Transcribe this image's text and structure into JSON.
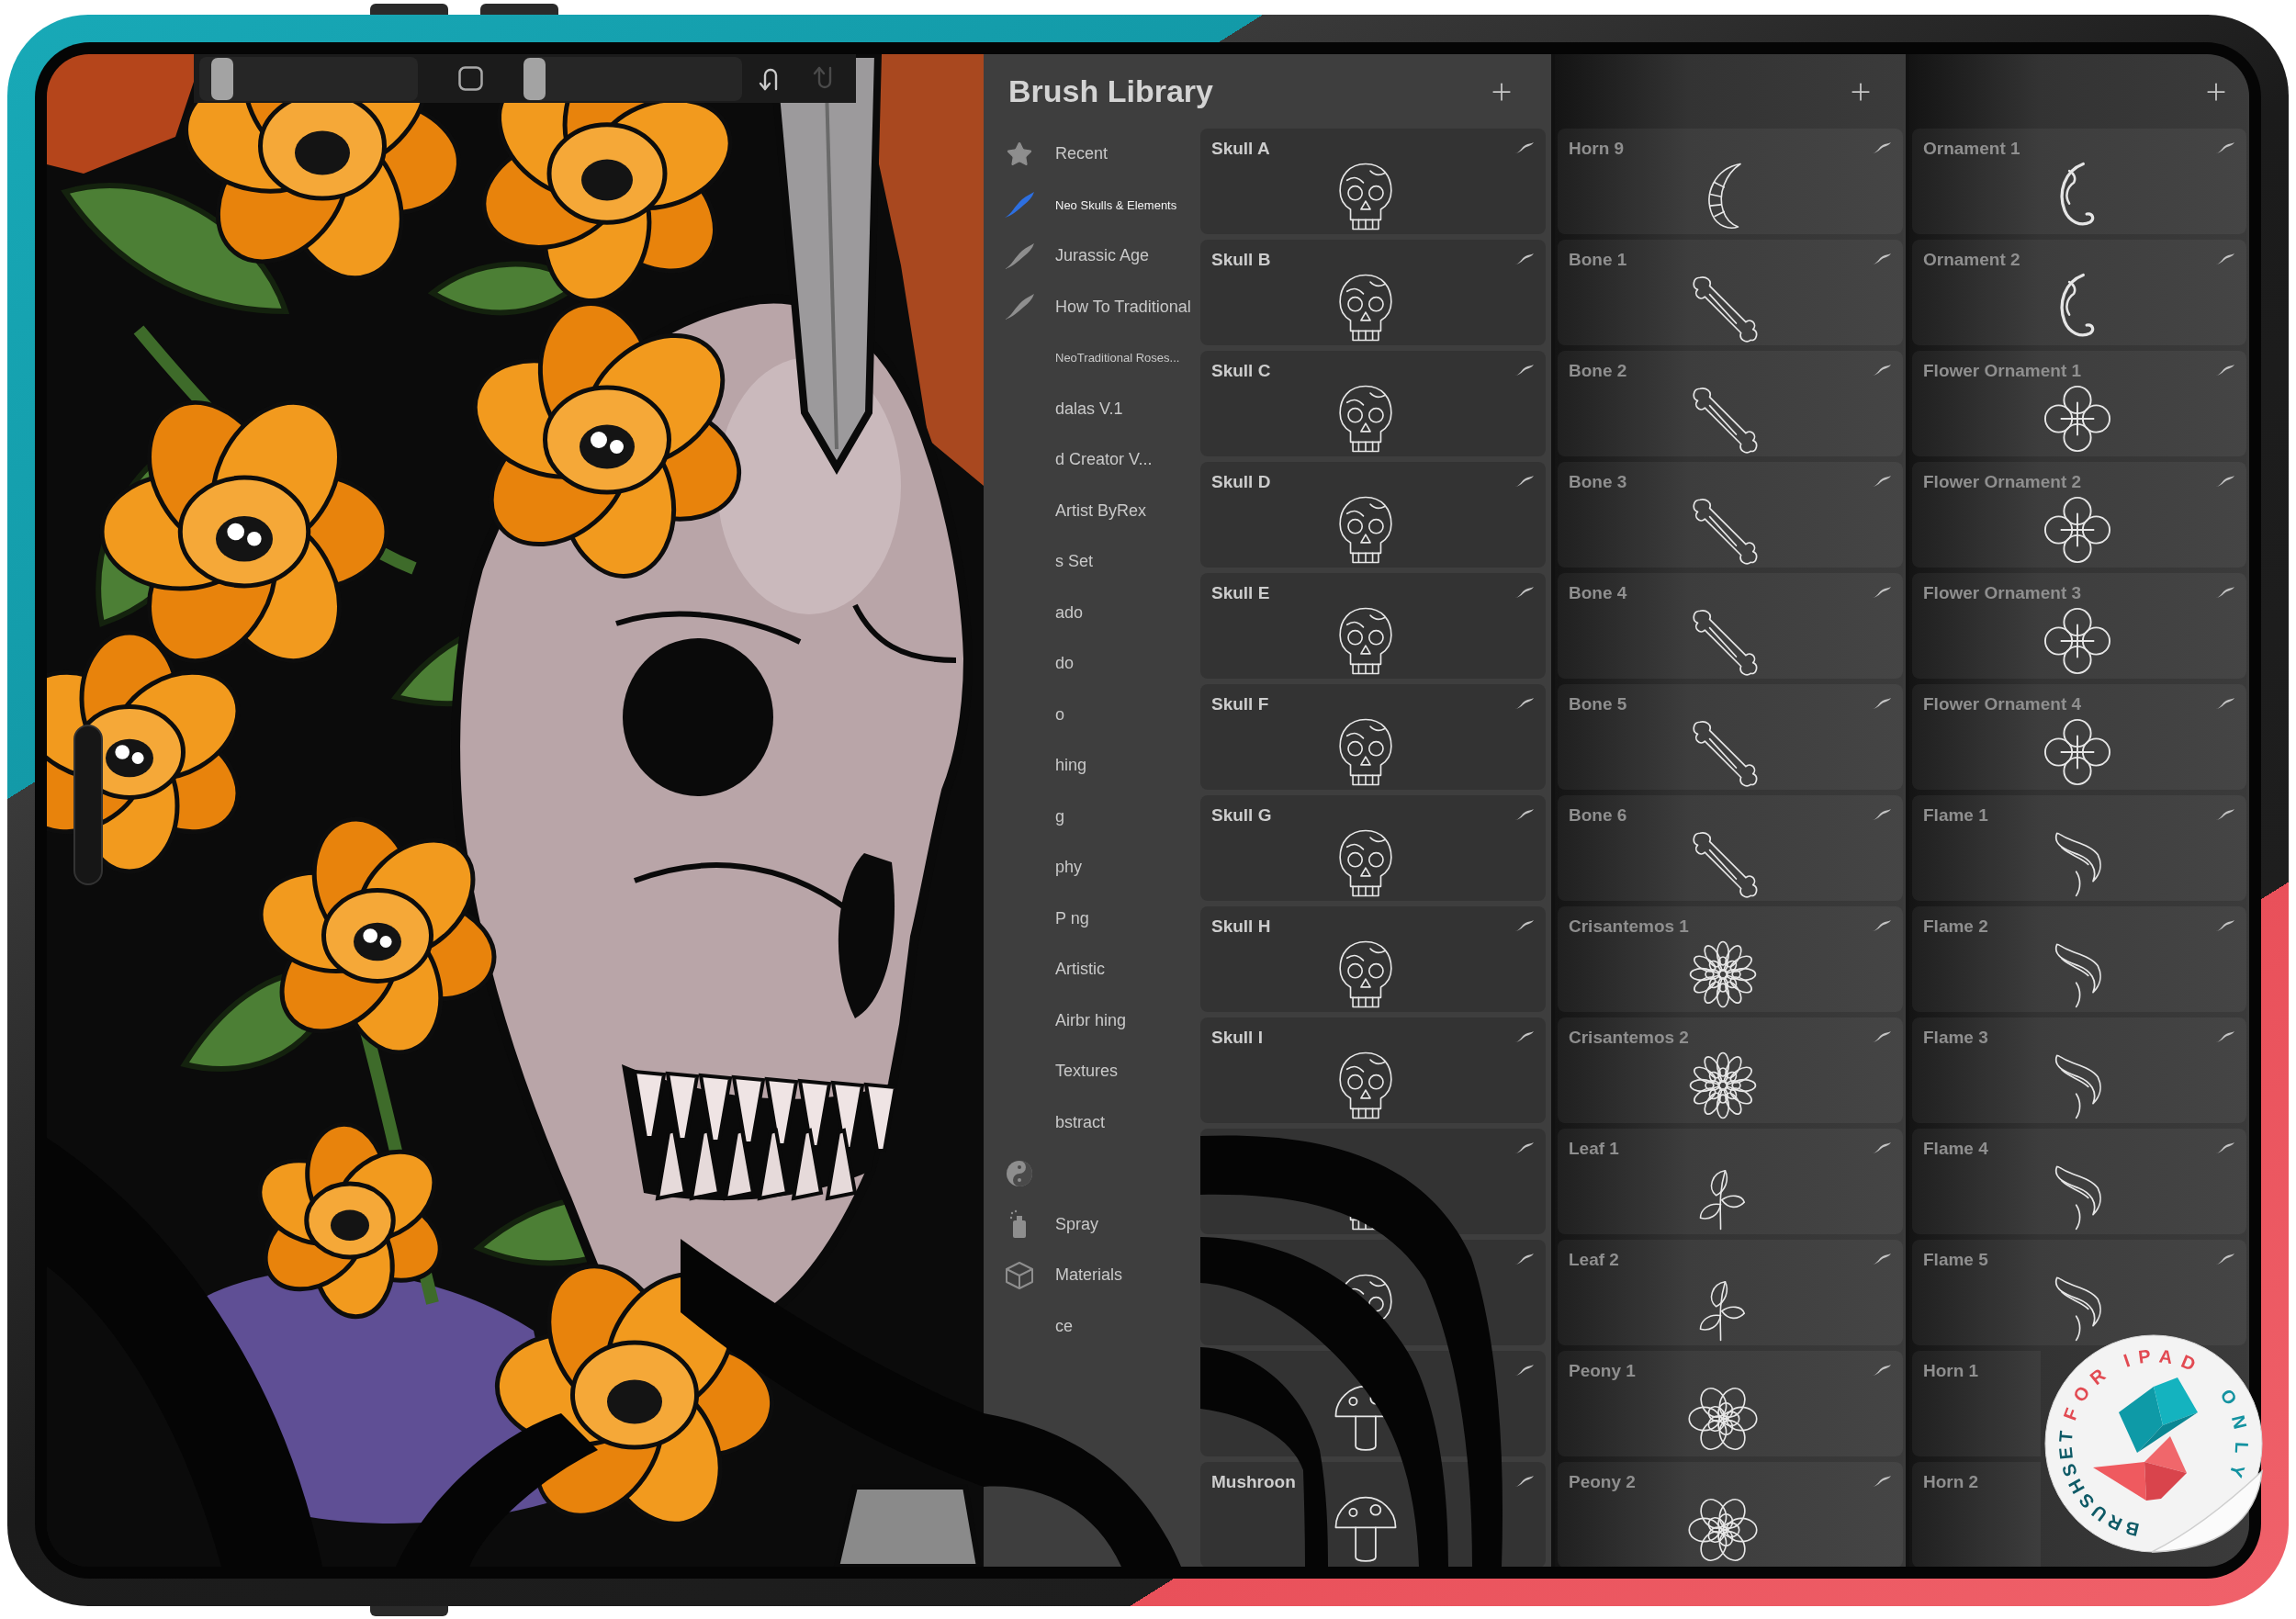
{
  "toolbar": {
    "size_slider": {
      "level": 0.06
    },
    "opacity_slider": {
      "level": 0
    },
    "undo": {
      "disabled": false
    },
    "redo": {
      "disabled": true
    }
  },
  "brush_library": {
    "title": "Brush Library",
    "sidebar": [
      {
        "label": "Recent",
        "kind": "star",
        "selected": false
      },
      {
        "label": "Neo Skulls & Elements",
        "kind": "stroke",
        "selected": true
      },
      {
        "label": "Jurassic Age",
        "kind": "stroke",
        "selected": false
      },
      {
        "label": "How To Traditional",
        "kind": "stroke",
        "selected": false
      },
      {
        "label": "NeoTraditional Roses...",
        "kind": "text",
        "selected": false
      },
      {
        "label": "dalas V.1",
        "kind": "text",
        "selected": false
      },
      {
        "label": "d Creator V...",
        "kind": "text",
        "selected": false
      },
      {
        "label": "Artist ByRex",
        "kind": "text",
        "selected": false
      },
      {
        "label": "s Set",
        "kind": "text",
        "selected": false
      },
      {
        "label": "ado",
        "kind": "text",
        "selected": false
      },
      {
        "label": "do",
        "kind": "text",
        "selected": false
      },
      {
        "label": "o",
        "kind": "text",
        "selected": false
      },
      {
        "label": "hing",
        "kind": "text",
        "selected": false
      },
      {
        "label": "g",
        "kind": "text",
        "selected": false
      },
      {
        "label": "phy",
        "kind": "text",
        "selected": false
      },
      {
        "label": "P ng",
        "kind": "text",
        "selected": false
      },
      {
        "label": "Artistic",
        "kind": "text",
        "selected": false
      },
      {
        "label": "Airbr hing",
        "kind": "text",
        "selected": false
      },
      {
        "label": "Textures",
        "kind": "text",
        "selected": false
      },
      {
        "label": "bstract",
        "kind": "text",
        "selected": false
      },
      {
        "kind": "yin-yang",
        "selected": false
      },
      {
        "label": "Spray",
        "kind": "spray",
        "selected": false
      },
      {
        "label": "Materials",
        "kind": "cube",
        "selected": false
      },
      {
        "label": "ce",
        "kind": "text",
        "selected": false
      }
    ],
    "columns": [
      {
        "cards": [
          {
            "name": "Skull A",
            "kind": "skull"
          },
          {
            "name": "Skull B",
            "kind": "skull"
          },
          {
            "name": "Skull C",
            "kind": "skull"
          },
          {
            "name": "Skull D",
            "kind": "skull"
          },
          {
            "name": "Skull E",
            "kind": "skull"
          },
          {
            "name": "Skull F",
            "kind": "skull"
          },
          {
            "name": "Skull G",
            "kind": "skull"
          },
          {
            "name": "Skull H",
            "kind": "skull"
          },
          {
            "name": "Skull I",
            "kind": "skull"
          },
          {
            "kind": "skull"
          },
          {
            "kind": "skull"
          },
          {
            "kind": "mushroom"
          },
          {
            "name": "Mushroon",
            "kind": "mushroom"
          }
        ]
      },
      {
        "cards": [
          {
            "name": "Horn 9",
            "kind": "horn"
          },
          {
            "name": "Bone 1",
            "kind": "bone"
          },
          {
            "name": "Bone 2",
            "kind": "bone"
          },
          {
            "name": "Bone 3",
            "kind": "bone"
          },
          {
            "name": "Bone 4",
            "kind": "bone"
          },
          {
            "name": "Bone 5",
            "kind": "bone"
          },
          {
            "name": "Bone 6",
            "kind": "bone"
          },
          {
            "name": "Crisantemos 1",
            "kind": "chrysanthemum"
          },
          {
            "name": "Crisantemos 2",
            "kind": "chrysanthemum"
          },
          {
            "name": "Leaf 1",
            "kind": "leaf"
          },
          {
            "name": "Leaf 2",
            "kind": "leaf"
          },
          {
            "name": "Peony 1",
            "kind": "peony"
          },
          {
            "name": "Peony 2",
            "kind": "peony"
          }
        ]
      },
      {
        "cards": [
          {
            "name": "Ornament 1",
            "kind": "ornament"
          },
          {
            "name": "Ornament 2",
            "kind": "ornament"
          },
          {
            "name": "Flower Ornament 1",
            "kind": "flower-ornament"
          },
          {
            "name": "Flower Ornament 2",
            "kind": "flower-ornament"
          },
          {
            "name": "Flower Ornament 3",
            "kind": "flower-ornament"
          },
          {
            "name": "Flower Ornament 4",
            "kind": "flower-ornament"
          },
          {
            "name": "Flame 1",
            "kind": "flame"
          },
          {
            "name": "Flame 2",
            "kind": "flame"
          },
          {
            "name": "Flame 3",
            "kind": "flame"
          },
          {
            "name": "Flame 4",
            "kind": "flame"
          },
          {
            "name": "Flame 5",
            "kind": "flame"
          },
          {
            "name": "Horn 1",
            "covered": true
          },
          {
            "name": "Horn 2",
            "covered": true
          }
        ]
      }
    ]
  },
  "sticker": {
    "text_parts": [
      {
        "text": "FOR IPAD",
        "color": "#e24a52"
      },
      {
        "text": "ONLY",
        "color": "#1392a0"
      },
      {
        "text": "BRUSHSET",
        "color": "#0e5a66"
      }
    ]
  }
}
